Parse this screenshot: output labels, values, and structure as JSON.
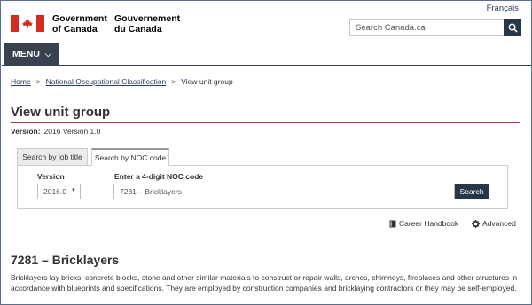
{
  "header": {
    "lang_toggle": "Français",
    "signature_en": [
      "Government",
      "of Canada"
    ],
    "signature_fr": [
      "Gouvernement",
      "du Canada"
    ],
    "search_placeholder": "Search Canada.ca",
    "search_icon": "magnifier-icon"
  },
  "menu": {
    "label": "MENU",
    "icon": "chevron-down"
  },
  "breadcrumb": {
    "items": [
      "Home",
      "National Occupational Classification"
    ],
    "current": "View unit group",
    "separator": ">"
  },
  "page": {
    "title": "View unit group",
    "version_label": "Version:",
    "version_value": "2016 Version 1.0"
  },
  "tabs": [
    {
      "label": "Search by job title",
      "active": false
    },
    {
      "label": "Search by NOC code",
      "active": true
    }
  ],
  "form": {
    "version_label": "Version",
    "version_value": "2016.0",
    "noc_label": "Enter a 4-digit NOC code",
    "noc_value": "7281 – Bricklayers",
    "search_label": "Search"
  },
  "actions": {
    "career_handbook": "Career Handbook",
    "advanced": "Advanced"
  },
  "unit_group": {
    "heading": "7281 – Bricklayers",
    "description": "Bricklayers lay bricks, concrete blocks, stone and other similar materials to construct or repair walls, arches, chimneys, fireplaces and other structures in accordance with blueprints and specifications. They are employed by construction companies and bricklaying contractors or they may be self-employed."
  },
  "colors": {
    "flag_red": "#d52b1e",
    "nav_dark": "#26374a",
    "menu_bg": "#38414d",
    "title_rule": "#af3c43",
    "link": "#284162"
  }
}
